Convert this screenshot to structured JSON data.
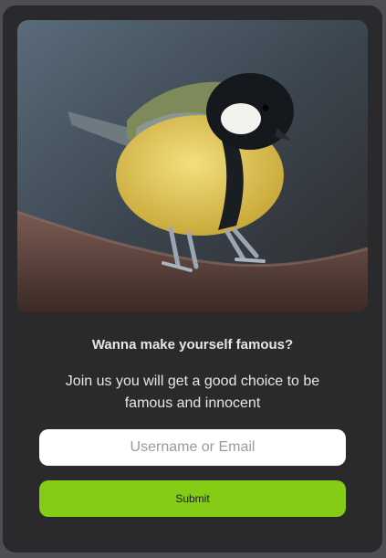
{
  "card": {
    "headline": "Wanna make yourself famous?",
    "subtext": "Join us you will get a good choice to be famous and innocent",
    "input": {
      "value": "",
      "placeholder": "Username or Email"
    },
    "submit_label": "Submit",
    "image": {
      "icon": "bird-photo"
    }
  },
  "colors": {
    "page_background": "#4d4d52",
    "card_background": "#2a2a2d",
    "text": "#e6e6e6",
    "accent": "#84cc16",
    "input_background": "#ffffff"
  }
}
